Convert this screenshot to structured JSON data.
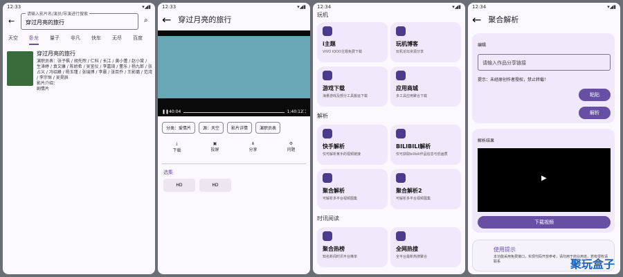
{
  "p1": {
    "time": "12:33",
    "label": "请输入影片名/演员/导演进行搜索",
    "query": "穿过月亮的旅行",
    "tabs": [
      "天空",
      "卧龙",
      "量子",
      "非凡",
      "快车",
      "无尽",
      "百度"
    ],
    "title": "穿过月亮的旅行",
    "cast": "演职员表：张子枫 / 胡先煦 / 仁科 / 长江 / 黄小蕾 / 赵小棠 / 生涛婷 / 袁文康 / 陈娇希 / 吴宜仪 / 李嘉琦 / 董乐 / 杨九郎 / 张占义 / 冯绍峰 / 杨玉瑾 / 张瑞博 / 李晨 / 张百乔 / 王影璐 / 范湾 / 李宗恒 / 吴昊辰",
    "intro": "影片介绍：",
    "genre": "剧情片"
  },
  "p2": {
    "time": "12:33",
    "title": "穿过月亮的旅行",
    "t0": "40:04",
    "t1": "1:40:12",
    "chips": [
      "分类：爱情片",
      "源：天空",
      "影片详情",
      "演职员表"
    ],
    "acts": [
      "下载",
      "投屏",
      "分享",
      "问题"
    ],
    "sel": "选集",
    "ep": [
      "HD",
      "HD"
    ]
  },
  "p3": {
    "time": "12:34",
    "s1": "玩机",
    "s2": "解析",
    "s3": "时讯阅读",
    "cards": [
      {
        "t": "i主题",
        "s": "VIVO IQOO主题免费下载"
      },
      {
        "t": "玩机博客",
        "s": "玩机论坛资源分享"
      },
      {
        "t": "游戏下载",
        "s": "海量游戏及部分工具搬运下载"
      },
      {
        "t": "应用商城",
        "s": "多工具应用聚合下载"
      },
      {
        "t": "快手解析",
        "s": "仅可解析某手的视频链接"
      },
      {
        "t": "BILIBILI解析",
        "s": "仅可获取bilibili作品信息与低画质"
      },
      {
        "t": "聚合解析",
        "s": "可解析多平台视频图集"
      },
      {
        "t": "聚合解析2",
        "s": "可解析多平台视频图集"
      },
      {
        "t": "聚合热榜",
        "s": "知名新闻时讯平台推单"
      },
      {
        "t": "全网热搜",
        "s": "全平台最新热搜聚合"
      }
    ]
  },
  "p4": {
    "time": "12:34",
    "title": "聚合解析",
    "edit": "编辑",
    "ph": "请输入作品分享链接",
    "tip": "提示：未经原创作者授权，禁止转载！",
    "paste": "粘贴",
    "parse": "解析",
    "res": "解析结果",
    "dl": "下载视频",
    "use": "使用提示",
    "usetxt": "本功能采用免费接口，实现代码开放参考，请勿用于商业用途，若有侵权请联系",
    "wm": "聚玩盒子"
  }
}
